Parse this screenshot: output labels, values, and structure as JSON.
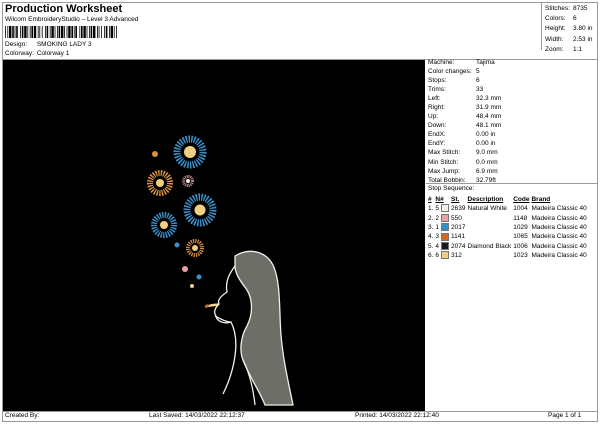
{
  "header": {
    "title": "Production Worksheet",
    "software": "Wilcom EmbroideryStudio – Level 3 Advanced",
    "design_label": "Design:",
    "design_value": "SMOKING LADY 3",
    "colorway_label": "Colorway:",
    "colorway_value": "Colorway 1"
  },
  "summary": [
    {
      "label": "Stitches:",
      "value": "8735"
    },
    {
      "label": "Colors:",
      "value": "6"
    },
    {
      "label": "Height:",
      "value": "3.80 in"
    },
    {
      "label": "Width:",
      "value": "2.53 in"
    },
    {
      "label": "Zoom:",
      "value": "1:1"
    }
  ],
  "params": [
    {
      "label": "Machine:",
      "value": "Tajima"
    },
    {
      "label": "Color changes:",
      "value": "5"
    },
    {
      "label": "Stops:",
      "value": "6"
    },
    {
      "label": "Trims:",
      "value": "33"
    },
    {
      "label": "Left:",
      "value": "32.3 mm"
    },
    {
      "label": "Right:",
      "value": "31.9 mm"
    },
    {
      "label": "Up:",
      "value": "48.4 mm"
    },
    {
      "label": "Down:",
      "value": "48.1 mm"
    },
    {
      "label": "EndX:",
      "value": "0.00 in"
    },
    {
      "label": "EndY:",
      "value": "0.00 in"
    },
    {
      "label": "Max Stitch:",
      "value": "9.0 mm"
    },
    {
      "label": "Min Stitch:",
      "value": "0.0 mm"
    },
    {
      "label": "Max Jump:",
      "value": "6.9 mm"
    },
    {
      "label": "Total Bobbin:",
      "value": "32.79ft"
    }
  ],
  "stop_sequence": {
    "title": "Stop Sequence:",
    "headers": [
      "#",
      "N#",
      "St.",
      "Description",
      "Code",
      "Brand"
    ],
    "rows": [
      {
        "num": "1.",
        "n": "5",
        "color": "#f2f0e6",
        "st": "2639",
        "desc": "Natural White",
        "code": "1004",
        "brand": "Madeira Classic 40"
      },
      {
        "num": "2.",
        "n": "2",
        "color": "#e8a0a8",
        "st": "550",
        "desc": "",
        "code": "1148",
        "brand": "Madeira Classic 40"
      },
      {
        "num": "3.",
        "n": "1",
        "color": "#3a8ec8",
        "st": "2017",
        "desc": "",
        "code": "1029",
        "brand": "Madeira Classic 40"
      },
      {
        "num": "4.",
        "n": "3",
        "color": "#d2691e",
        "st": "1141",
        "desc": "",
        "code": "1065",
        "brand": "Madeira Classic 40"
      },
      {
        "num": "5.",
        "n": "4",
        "color": "#1a1a1a",
        "st": "2074",
        "desc": "Diamond Black",
        "code": "1006",
        "brand": "Madeira Classic 40"
      },
      {
        "num": "6.",
        "n": "6",
        "color": "#f0d080",
        "st": "312",
        "desc": "",
        "code": "1023",
        "brand": "Madeira Classic 40"
      }
    ]
  },
  "footer": {
    "created_by": "Created By:",
    "last_saved": "Last Saved: 14/03/2022 22:12:37",
    "printed": "Printed: 14/03/2022 22:12:40",
    "page": "Page 1 of 1"
  },
  "colors": {
    "canvas_bg": "#000000",
    "frame": "#999999"
  }
}
